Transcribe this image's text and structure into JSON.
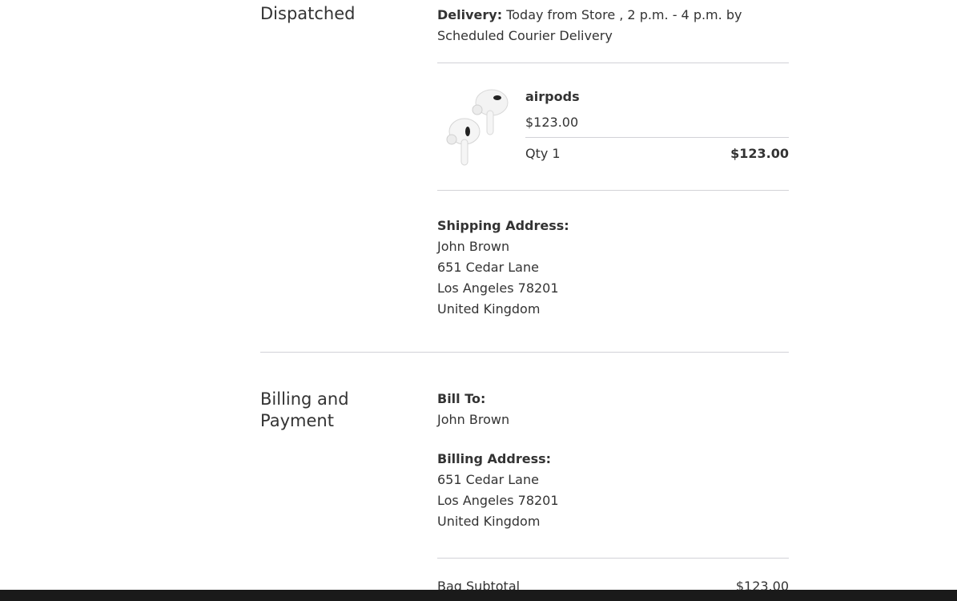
{
  "dispatched": {
    "title": "Dispatched",
    "delivery_label": "Delivery:",
    "delivery_text": " Today from Store , 2 p.m. - 4 p.m. by Scheduled Courier Delivery",
    "item": {
      "name": "airpods",
      "price": "$123.00",
      "qty": "Qty 1",
      "total": "$123.00",
      "image_icon": "airpods-image"
    },
    "shipping": {
      "label": "Shipping Address:",
      "lines": [
        "John Brown",
        "651 Cedar Lane",
        "Los Angeles 78201",
        "United Kingdom"
      ]
    }
  },
  "billing": {
    "title_line1": "Billing and",
    "title_line2": "Payment",
    "bill_to_label": "Bill To:",
    "bill_to_name": "John Brown",
    "address_label": "Billing Address:",
    "address_lines": [
      "651 Cedar Lane",
      "Los Angeles 78201",
      "United Kingdom"
    ],
    "subtotal_label": "Bag Subtotal",
    "subtotal_value": "$123.00"
  },
  "colors": {
    "text": "#333333",
    "divider": "#d2d2d7",
    "bottom_bar": "#1a1a1a"
  }
}
